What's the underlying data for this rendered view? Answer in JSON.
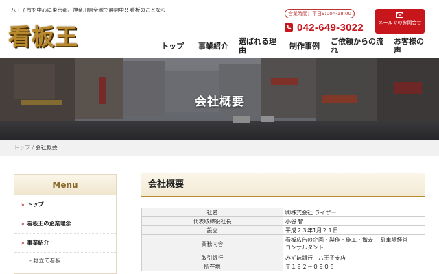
{
  "header": {
    "tagline": "八王子市を中心に東京都、神奈川県全域で展開中!! 看板のことなら",
    "logo_text": "看板王",
    "hours": "営業時間：平日9:00～18:00",
    "phone": "042-649-3022",
    "mail_label": "メールでのお問合せ"
  },
  "nav": {
    "items": [
      {
        "label": "トップ"
      },
      {
        "label": "事業紹介"
      },
      {
        "label": "選ばれる理由"
      },
      {
        "label": "制作事例"
      },
      {
        "label": "ご依頼からの流れ"
      },
      {
        "label": "お客様の声"
      }
    ]
  },
  "hero": {
    "title": "会社概要"
  },
  "breadcrumb": {
    "home": "トップ",
    "sep": "/",
    "current": "会社概要"
  },
  "sidebar": {
    "title": "Menu",
    "items": [
      {
        "label": "トップ"
      },
      {
        "label": "看板王の企業理念"
      },
      {
        "label": "事業紹介"
      }
    ],
    "sub_items": [
      {
        "label": "- 野立て看板"
      }
    ]
  },
  "main": {
    "title": "会社概要",
    "rows": [
      {
        "key": "社名",
        "value": "㈱株式会社 ライザー"
      },
      {
        "key": "代表取締役社長",
        "value": "小谷 智"
      },
      {
        "key": "設立",
        "value": "平成２３年1月２１日"
      },
      {
        "key": "業務内容",
        "value": "看板広告の企画・製作・施工・撤去　 駐車場経営",
        "value2": "コンサルタント"
      },
      {
        "key": "取引銀行",
        "value": "みずほ銀行　八王子支店"
      },
      {
        "key": "所在地",
        "value": "〒１９２－０９０６"
      }
    ]
  },
  "colors": {
    "accent": "#c8161d",
    "gold": "#b8892e"
  }
}
